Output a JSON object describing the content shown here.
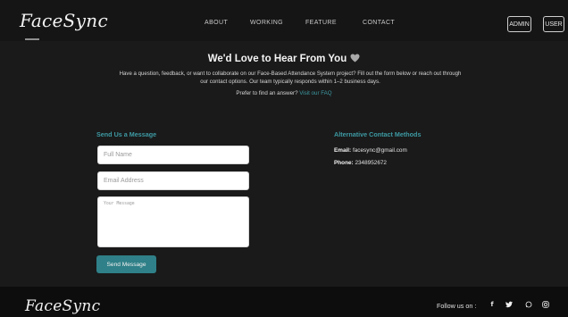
{
  "header": {
    "logo": "FaceSync",
    "nav": {
      "about": "ABOUT",
      "working": "WORKING",
      "feature": "FEATURE",
      "contact": "CONTACT"
    },
    "admin_label": "ADMIN",
    "user_label": "USER"
  },
  "intro": {
    "heading": "We'd Love to Hear From You",
    "heading_icon": "heart-icon",
    "body": "Have a question, feedback, or want to collaborate on our Face-Based Attendance System project? Fill out the form below or reach out through our contact options. Our team typically responds within 1–2 business days.",
    "faq_prompt": "Prefer to find an answer?",
    "faq_link": "Visit our FAQ"
  },
  "form": {
    "title": "Send Us a Message",
    "name_placeholder": "Full Name",
    "email_placeholder": "Email Address",
    "message_placeholder": "Your Message",
    "submit_label": "Send Message"
  },
  "alt_contact": {
    "title": "Alternative Contact Methods",
    "email_label": "Email:",
    "email_value": "facesync@gmail.com",
    "phone_label": "Phone:",
    "phone_value": "2348952672"
  },
  "footer": {
    "logo": "FaceSync",
    "follow_label": "Follow us on :",
    "socials": [
      "facebook-icon",
      "twitter-icon",
      "whatsapp-icon",
      "instagram-icon"
    ]
  },
  "colors": {
    "background": "#1a1a1a",
    "header": "#151515",
    "footer": "#0d0d0d",
    "accent": "#3d9aa3",
    "button": "#2f8088"
  }
}
